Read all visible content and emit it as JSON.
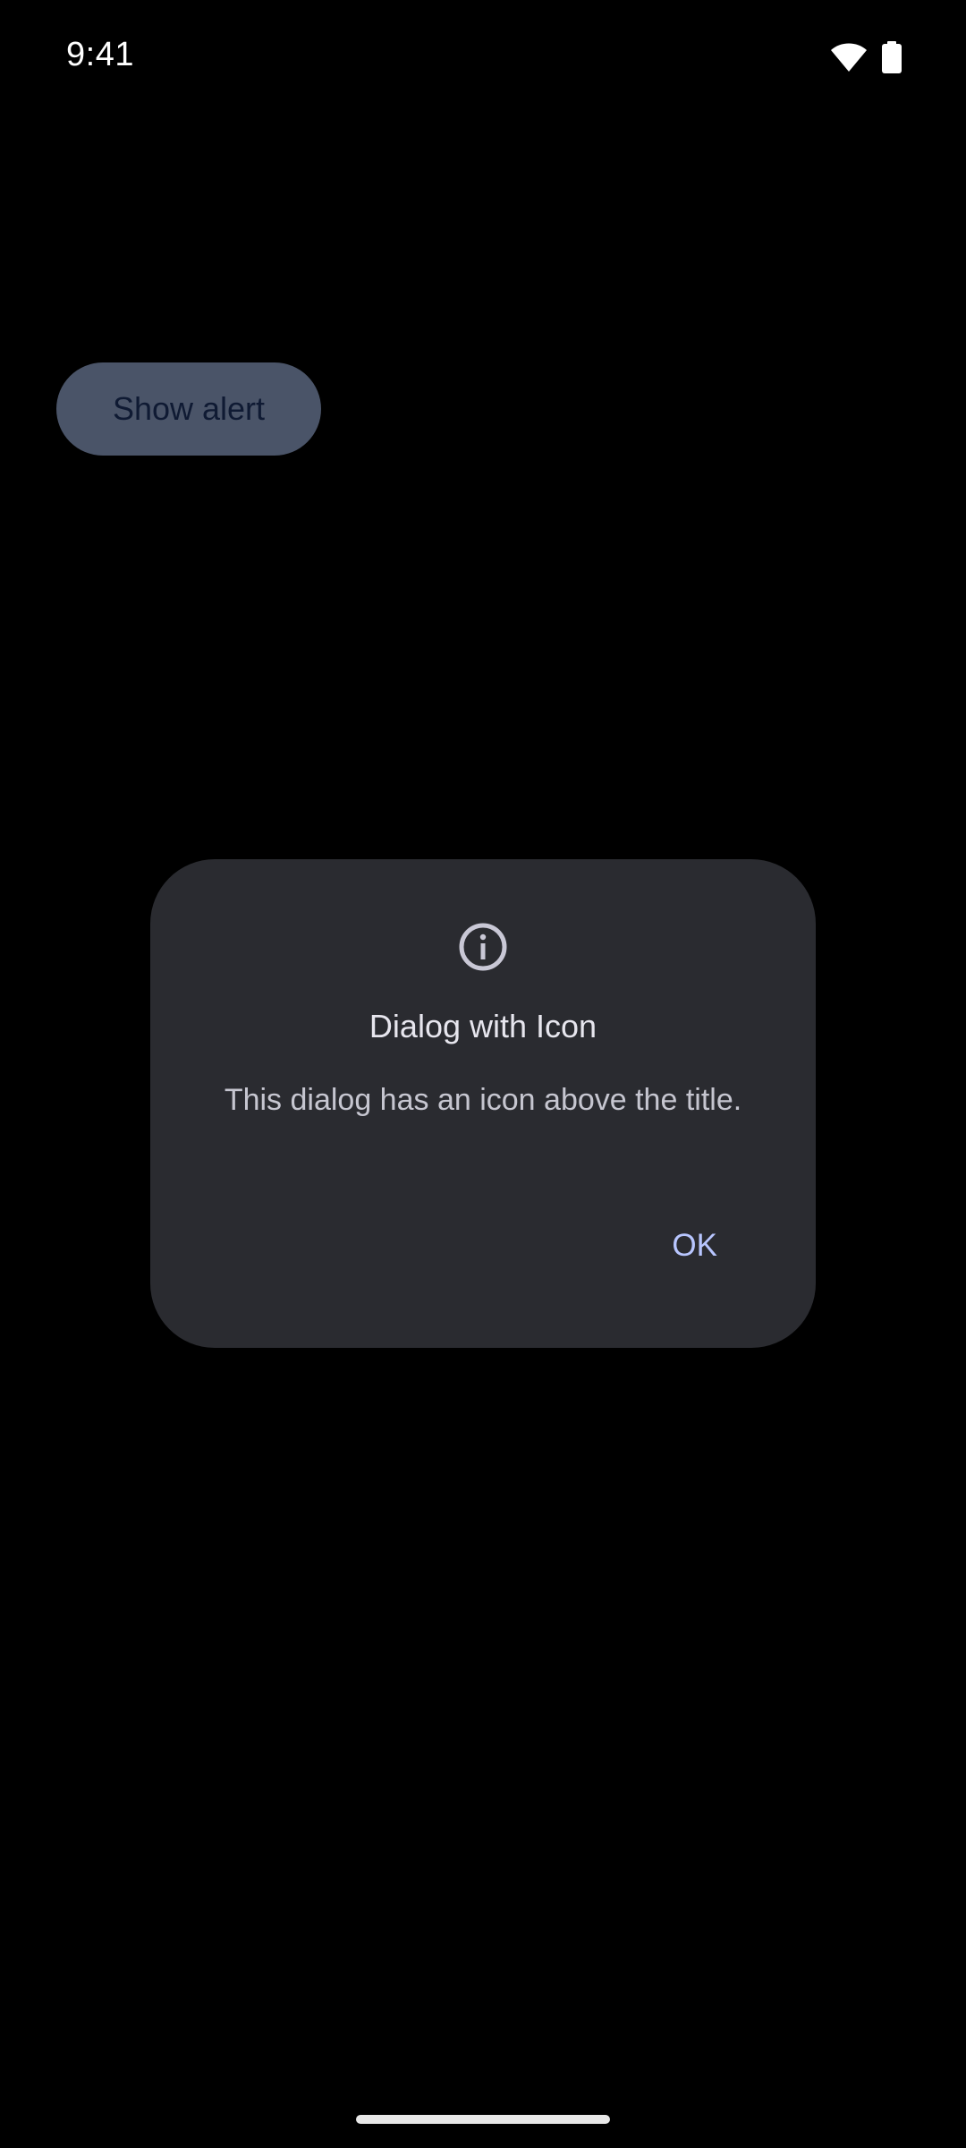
{
  "status_bar": {
    "time": "9:41",
    "icons": [
      "wifi-icon",
      "battery-icon"
    ]
  },
  "main": {
    "show_alert_label": "Show alert"
  },
  "dialog": {
    "icon": "info-icon",
    "title": "Dialog with Icon",
    "message": "This dialog has an icon above the title.",
    "confirm_label": "OK"
  },
  "colors": {
    "background": "#000000",
    "dialog_surface": "#2a2b30",
    "accent": "#b8c6ff",
    "button_dimmed": "#4a5468"
  }
}
